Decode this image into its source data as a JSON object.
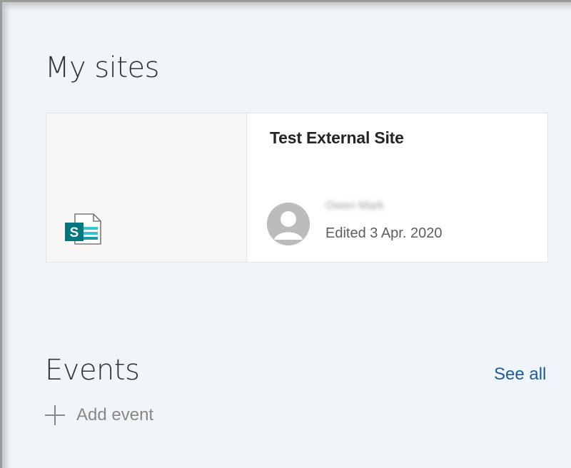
{
  "sections": {
    "my_sites": {
      "title": "My sites",
      "sites": [
        {
          "name": "Test External Site",
          "author": "Owen Mark",
          "edited": "Edited 3 Apr. 2020",
          "icon": "sharepoint-site-icon"
        }
      ]
    },
    "events": {
      "title": "Events",
      "see_all_label": "See all",
      "add_event_label": "Add event",
      "add_icon": "plus-icon"
    }
  },
  "colors": {
    "page_background": "#f0f5f9",
    "link": "#1f5c99",
    "sharepoint_green": "#03787c",
    "muted_text": "#8a8886"
  }
}
